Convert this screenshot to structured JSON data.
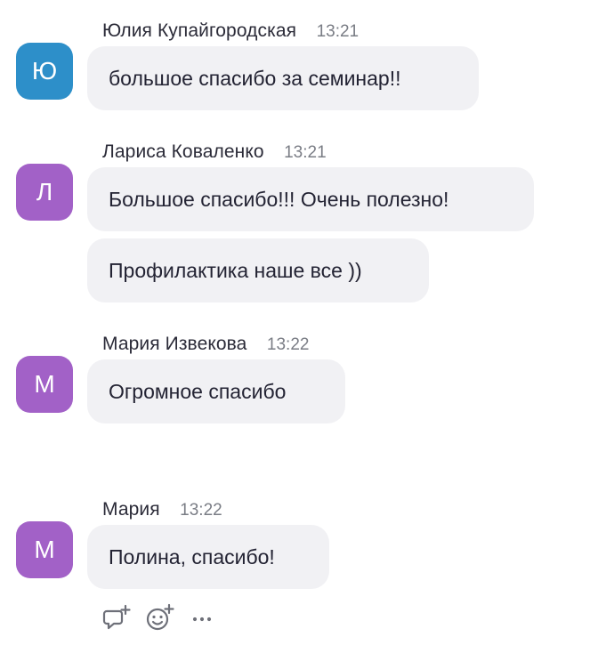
{
  "colors": {
    "avatar_blue": "#2d8fc9",
    "avatar_purple": "#a261c7",
    "bubble_bg": "#f1f1f4",
    "timestamp": "#7a7d85",
    "icon": "#6e7079"
  },
  "messages": [
    {
      "avatar_letter": "Ю",
      "avatar_color": "#2d8fc9",
      "sender": "Юлия Купайгородская",
      "time": "13:21",
      "texts": [
        "большое спасибо за семинар!!"
      ]
    },
    {
      "avatar_letter": "Л",
      "avatar_color": "#a261c7",
      "sender": "Лариса Коваленко",
      "time": "13:21",
      "texts": [
        "Большое спасибо!!! Очень полезно!",
        "Профилактика наше все ))"
      ]
    },
    {
      "avatar_letter": "М",
      "avatar_color": "#a261c7",
      "sender": "Мария Извекова",
      "time": "13:22",
      "texts": [
        "Огромное спасибо"
      ]
    },
    {
      "avatar_letter": "М",
      "avatar_color": "#a261c7",
      "sender": "Мария",
      "time": "13:22",
      "texts": [
        "Полина, спасибо!"
      ]
    }
  ],
  "actions": {
    "reply_icon": "reply-thread-icon",
    "emoji_icon": "add-reaction-icon",
    "more_icon": "more-options-icon"
  }
}
